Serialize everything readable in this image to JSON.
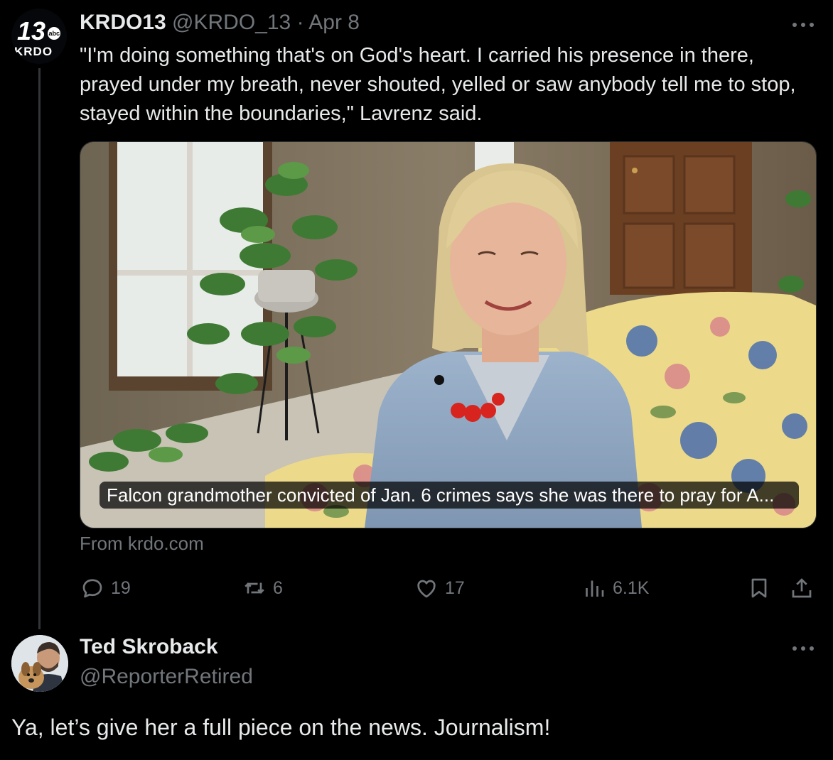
{
  "tweet": {
    "author_name": "KRDO13",
    "author_handle": "@KRDO_13",
    "separator": "·",
    "date": "Apr 8",
    "avatar_logo": {
      "number": "13",
      "network": "abc",
      "station": "KRDO"
    },
    "text": "\"I'm doing something that's on God's heart. I carried his presence in there, prayed under my breath, never shouted, yelled or saw anybody tell me to stop, stayed within the boundaries,\" Lavrenz said.",
    "card": {
      "title": "Falcon grandmother convicted of Jan. 6 crimes says she was there to pray for A...",
      "source": "From krdo.com"
    },
    "actions": {
      "replies": "19",
      "reposts": "6",
      "likes": "17",
      "views": "6.1K"
    },
    "icons": [
      "reply-icon",
      "repost-icon",
      "like-icon",
      "views-icon",
      "bookmark-icon",
      "share-icon",
      "more-icon"
    ]
  },
  "reply": {
    "author_name": "Ted Skroback",
    "author_handle": "@ReporterRetired",
    "text": "Ya, let’s give her a full piece on the news. Journalism!"
  },
  "colors": {
    "background": "#000000",
    "primary_text": "#e7e9ea",
    "secondary_text": "#71767b",
    "thread_line": "#333639"
  }
}
